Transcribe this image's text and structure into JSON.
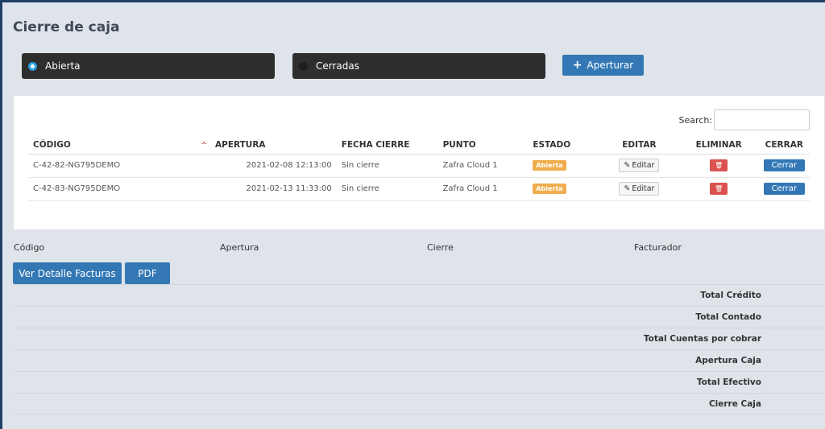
{
  "page": {
    "title": "Cierre de caja"
  },
  "filters": {
    "open_label": "Abierta",
    "closed_label": "Cerradas"
  },
  "actions": {
    "open_register_label": "Aperturar"
  },
  "search": {
    "label": "Search:",
    "value": ""
  },
  "table": {
    "headers": {
      "code": "CÓDIGO",
      "opening": "APERTURA",
      "close_date": "FECHA CIERRE",
      "point": "PUNTO",
      "status": "ESTADO",
      "edit": "EDITAR",
      "delete": "ELIMINAR",
      "close": "CERRAR"
    },
    "rows": [
      {
        "code": "C-42-82-NG795DEMO",
        "opening": "2021-02-08 12:13:00",
        "close_date": "Sin cierre",
        "point": "Zafra Cloud 1",
        "status": "Abierta",
        "edit": "Editar",
        "close": "Cerrar"
      },
      {
        "code": "C-42-83-NG795DEMO",
        "opening": "2021-02-13 11:33:00",
        "close_date": "Sin cierre",
        "point": "Zafra Cloud 1",
        "status": "Abierta",
        "edit": "Editar",
        "close": "Cerrar"
      }
    ]
  },
  "summary": {
    "code_label": "Código",
    "opening_label": "Apertura",
    "close_label": "Cierre",
    "biller_label": "Facturador",
    "detail_button": "Ver Detalle Facturas",
    "pdf_button": "PDF",
    "totals": [
      "Total Crédito",
      "Total Contado",
      "Total Cuentas por cobrar",
      "Apertura Caja",
      "Total Efectivo",
      "Cierre Caja"
    ]
  },
  "colors": {
    "primary": "#3378b5",
    "danger": "#d9534f",
    "warning": "#f0ad4e",
    "dark": "#2e2e2e",
    "background": "#dfe4ea"
  }
}
